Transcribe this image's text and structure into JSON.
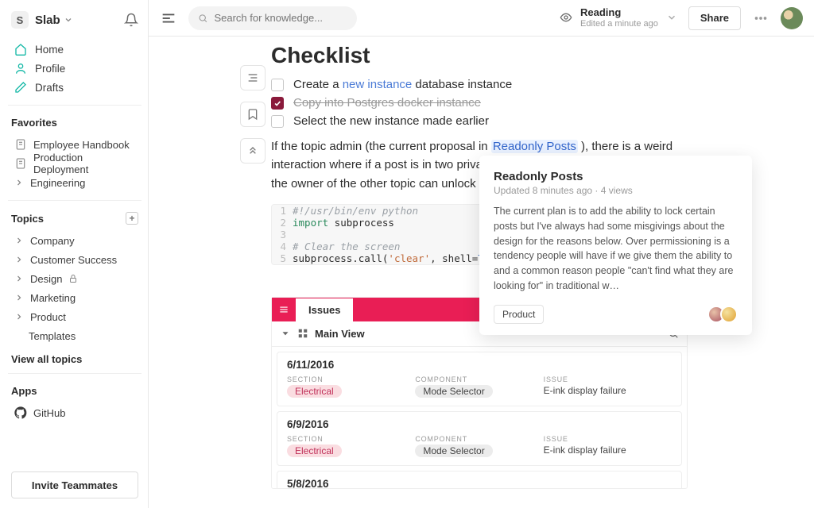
{
  "workspace": {
    "initial": "S",
    "name": "Slab"
  },
  "nav": {
    "home": "Home",
    "profile": "Profile",
    "drafts": "Drafts"
  },
  "favorites": {
    "heading": "Favorites",
    "items": [
      "Employee Handbook",
      "Production Deployment",
      "Engineering"
    ]
  },
  "topics": {
    "heading": "Topics",
    "items": [
      {
        "label": "Company"
      },
      {
        "label": "Customer Success"
      },
      {
        "label": "Design",
        "locked": true
      },
      {
        "label": "Marketing"
      },
      {
        "label": "Product",
        "children": [
          "Templates"
        ]
      }
    ],
    "view_all": "View all topics"
  },
  "apps": {
    "heading": "Apps",
    "github": "GitHub"
  },
  "invite_label": "Invite Teammates",
  "search": {
    "placeholder": "Search for knowledge..."
  },
  "status": {
    "label": "Reading",
    "sub": "Edited a minute ago"
  },
  "share_label": "Share",
  "doc": {
    "title": "Checklist",
    "tasks": [
      {
        "pre": "Create a ",
        "link": "new instance",
        "post": " database instance",
        "done": false
      },
      {
        "text": "Copy into Postgres docker instance",
        "done": true
      },
      {
        "text": "Select the new instance made earlier",
        "done": false
      }
    ],
    "para_a": "If the topic admin (the current proposal in ",
    "para_link": "Readonly Posts",
    "para_b": " ), there is a weird interaction where if a post is in two private ",
    "para_c": " the owner of the other topic can unlock it.",
    "code": [
      "#!/usr/bin/env python",
      "import subprocess",
      "",
      "# Clear the screen",
      "subprocess.call('clear', shell=True)"
    ]
  },
  "hover": {
    "title": "Readonly Posts",
    "meta": "Updated 8 minutes ago · 4 views",
    "body": "The current plan is to add the ability to lock certain posts but I've always had some misgivings about the design for the reasons below. Over permissioning is a tendency people will have if we give them the ability to and a common reason people \"can't find what they are looking for\" in traditional w…",
    "tag": "Product"
  },
  "issues": {
    "tab": "Issues",
    "view": "Main View",
    "labels": {
      "section": "SECTION",
      "component": "COMPONENT",
      "issue": "ISSUE"
    },
    "cards": [
      {
        "date": "6/11/2016",
        "section": "Electrical",
        "component": "Mode Selector",
        "issue": "E-ink display failure"
      },
      {
        "date": "6/9/2016",
        "section": "Electrical",
        "component": "Mode Selector",
        "issue": "E-ink display failure"
      },
      {
        "date": "5/8/2016",
        "section": "",
        "component": "",
        "issue": ""
      }
    ]
  }
}
